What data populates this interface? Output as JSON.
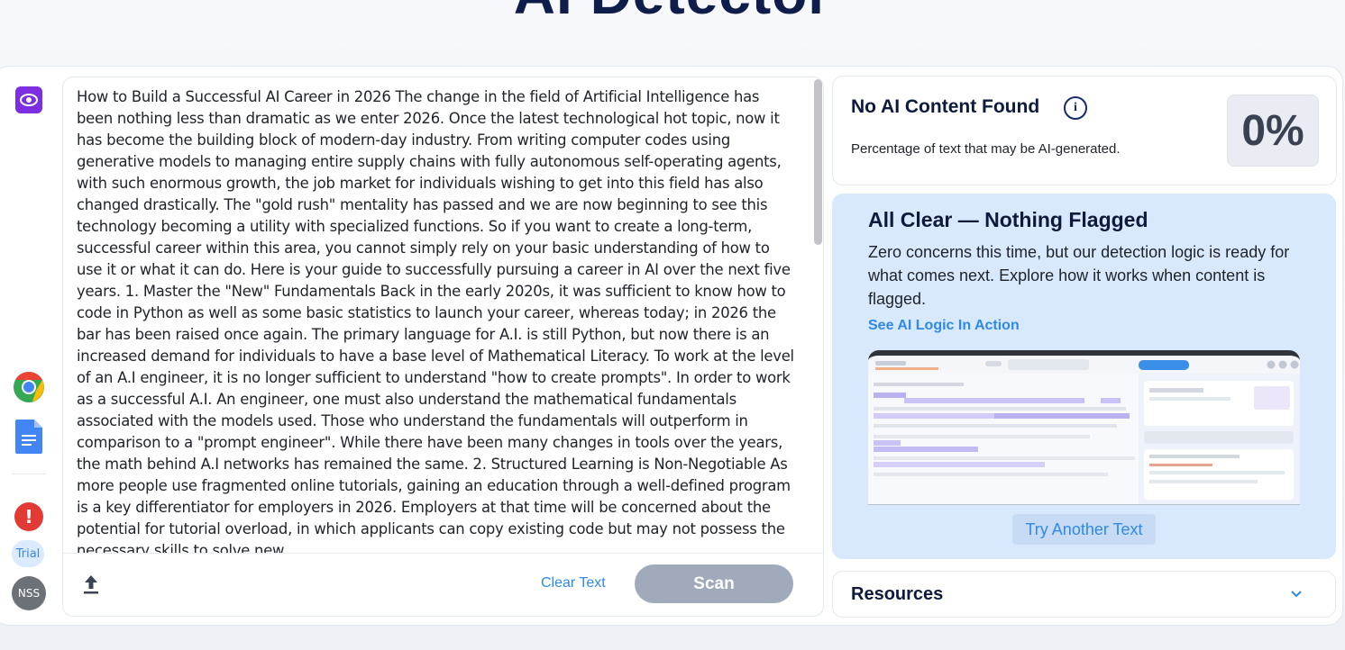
{
  "page": {
    "title": "AI Detector"
  },
  "rail": {
    "trial_label": "Trial",
    "avatar_initials": "NSS"
  },
  "editor": {
    "text": "How to Build a Successful AI Career in 2026 The change in the field of Artificial Intelligence has been nothing less than dramatic as we enter 2026. Once the latest technological hot topic, now it has become the building block of modern-day industry. From writing computer codes using generative models to managing entire supply chains with fully autonomous self-operating agents, with such enormous growth, the job market for individuals wishing to get into this field has also changed drastically. The \"gold rush\" mentality has passed and we are now beginning to see this technology becoming a utility with specialized functions. So if you want to create a long-term, successful career within this area, you cannot simply rely on your basic understanding of how to use it or what it can do. Here is your guide to successfully pursuing a career in AI over the next five years. 1. Master the \"New\" Fundamentals Back in the early 2020s, it was sufficient to know how to code in Python as well as some basic statistics to launch your career, whereas today; in 2026 the bar has been raised once again. The primary language for A.I. is still Python, but now there is an increased demand for individuals to have a base level of Mathematical Literacy. To work at the level of an A.I engineer, it is no longer sufficient to understand \"how to create prompts\". In order to work as a successful A.I. An engineer, one must also understand the mathematical fundamentals associated with the models used. Those who understand the fundamentals will outperform in comparison to a \"prompt engineer\". While there have been many changes in tools over the years, the math behind A.I networks has remained the same. 2. Structured Learning is Non-Negotiable As more people use fragmented online tutorials, gaining an education through a well-defined program is a key differentiator for employers in 2026. Employers at that time will be concerned about the potential for tutorial overload, in which applicants can copy existing code but may not possess the necessary skills to solve new",
    "clear_label": "Clear Text",
    "scan_label": "Scan"
  },
  "result": {
    "title": "No AI Content Found",
    "subtitle": "Percentage of text that may be AI-generated.",
    "percent": "0%"
  },
  "clear_card": {
    "title": "All Clear — Nothing Flagged",
    "description": "Zero concerns this time, but our detection logic is ready for what comes next. Explore how it works when content is flagged.",
    "link_label": "See AI Logic In Action",
    "try_label": "Try Another Text"
  },
  "resources": {
    "title": "Resources"
  },
  "colors": {
    "accent": "#2e8ae6",
    "scan_button": "#a0aabb",
    "clear_card_bg": "#d9e9fd",
    "alert": "#e23a34",
    "eye_button": "#7b2fe0"
  },
  "icons": [
    "eye-icon",
    "chrome-icon",
    "google-docs-icon",
    "alert-icon",
    "upload-icon",
    "info-icon",
    "chevron-down-icon"
  ]
}
